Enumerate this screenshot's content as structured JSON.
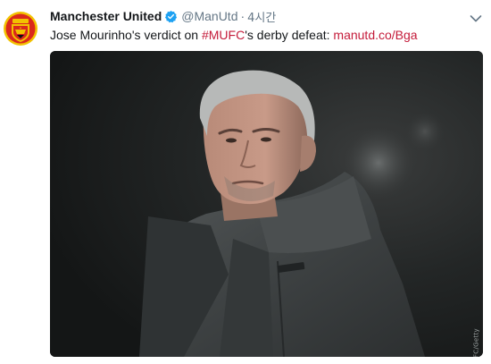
{
  "tweet": {
    "author_name": "Manchester United",
    "handle": "@ManUtd",
    "separator": "·",
    "time": "4시간",
    "avatar_icon": "manchester-united-crest-icon",
    "verified_icon": "verified-badge-icon",
    "menu_icon": "chevron-down-icon",
    "text_before": "Jose Mourinho's verdict on ",
    "hashtag": "#MUFC",
    "text_middle": "'s derby defeat: ",
    "link": "manutd.co/Bga",
    "accent_color": "#c41b3a",
    "verified_color": "#1da1f2",
    "media": {
      "credit": "© MUFC/Getty"
    }
  }
}
